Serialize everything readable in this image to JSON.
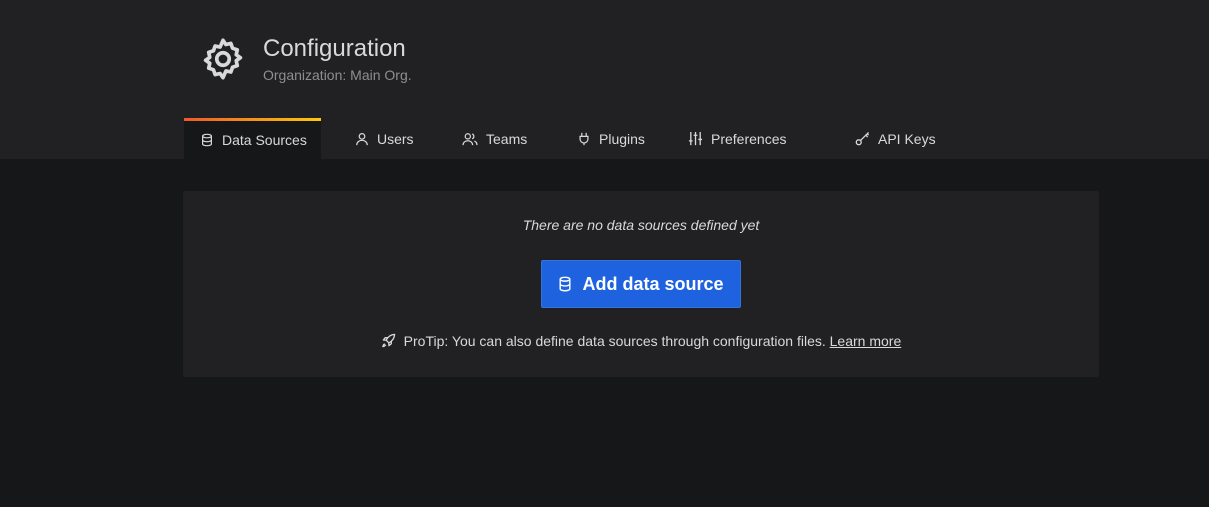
{
  "header": {
    "title": "Configuration",
    "subtitle": "Organization: Main Org.",
    "icon": "gear-icon"
  },
  "tabs": [
    {
      "label": "Data Sources",
      "icon": "database-icon",
      "active": true
    },
    {
      "label": "Users",
      "icon": "user-icon",
      "active": false
    },
    {
      "label": "Teams",
      "icon": "users-icon",
      "active": false
    },
    {
      "label": "Plugins",
      "icon": "plug-icon",
      "active": false
    },
    {
      "label": "Preferences",
      "icon": "sliders-icon",
      "active": false
    },
    {
      "label": "API Keys",
      "icon": "key-icon",
      "active": false
    }
  ],
  "empty_state": {
    "message": "There are no data sources defined yet",
    "button_label": "Add data source",
    "button_icon": "database-icon",
    "protip_text": "ProTip: You can also define data sources through configuration files.",
    "protip_icon": "rocket-icon",
    "learn_more_label": "Learn more"
  },
  "colors": {
    "background": "#161719",
    "header_bg": "#212124",
    "panel_bg": "#212124",
    "primary_button": "#1f62e0",
    "tab_accent_start": "#f05a28",
    "tab_accent_end": "#fbca0a"
  }
}
